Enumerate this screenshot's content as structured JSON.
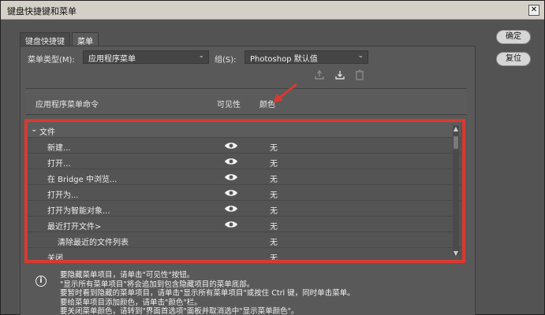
{
  "window": {
    "title": "键盘快捷键和菜单",
    "close_glyph": "✕"
  },
  "tabs": [
    {
      "label": "键盘快捷键",
      "active": false
    },
    {
      "label": "菜单",
      "active": true
    }
  ],
  "controls": {
    "menu_type_label": "菜单类型(M):",
    "menu_type_value": "应用程序菜单",
    "set_label": "组(S):",
    "set_value": "Photoshop 默认值"
  },
  "toolbar_icons": [
    "save-set-icon",
    "save-set-as-icon",
    "delete-set-icon"
  ],
  "table": {
    "headers": {
      "command": "应用程序菜单命令",
      "visibility": "可见性",
      "color": "颜色"
    },
    "group": {
      "label": "文件",
      "expanded": true
    },
    "rows": [
      {
        "command": "新建...",
        "visible": true,
        "color": "无",
        "indent": false
      },
      {
        "command": "打开...",
        "visible": true,
        "color": "无",
        "indent": false
      },
      {
        "command": "在 Bridge 中浏览...",
        "visible": true,
        "color": "无",
        "indent": false
      },
      {
        "command": "打开为...",
        "visible": true,
        "color": "无",
        "indent": false
      },
      {
        "command": "打开为智能对象...",
        "visible": true,
        "color": "无",
        "indent": false
      },
      {
        "command": "最近打开文件>",
        "visible": true,
        "color": "无",
        "indent": false
      },
      {
        "command": "清除最近的文件列表",
        "visible": false,
        "color": "无",
        "indent": true
      },
      {
        "command": "关闭",
        "visible": false,
        "color": "无",
        "indent": false
      }
    ]
  },
  "info_lines": [
    "要隐藏菜单项目，请单击\"可见性\"按钮。",
    "\"显示所有菜单项目\"将会追加到包含隐藏项目的菜单底部。",
    "要暂时看到隐藏的菜单项目，请单击\"显示所有菜单项目\"或按住 Ctrl 键，同时单击菜单。",
    "要给菜单项目添加颜色，请单击\"颜色\"栏。",
    "要关闭菜单颜色，请转到\"界面首选项\"面板并取消选中\"显示菜单颜色\"。"
  ],
  "buttons": {
    "ok": "确定",
    "reset": "复位"
  },
  "colors": {
    "highlight_border": "#d83a31",
    "dialog_background": "#535353"
  }
}
